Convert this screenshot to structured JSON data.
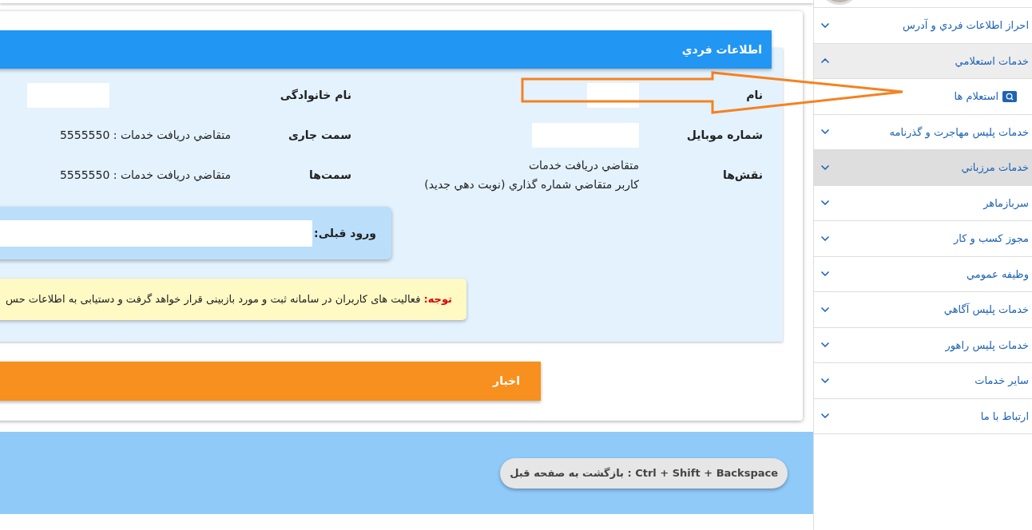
{
  "profile_card": {
    "title": "اطلاعات فردي",
    "fields": [
      {
        "label": "نام",
        "kind": "redacted"
      },
      {
        "label": "نام خانوادگی",
        "kind": "redacted"
      },
      {
        "label": "شماره موبایل",
        "kind": "redacted"
      },
      {
        "label": "سمت جاری",
        "kind": "text",
        "lines": [
          "متقاضي دريافت خدمات : 5555550"
        ]
      },
      {
        "label": "نقش‌ها",
        "kind": "text",
        "lines": [
          "متقاضي دريافت خدمات",
          "كاربر متقاضي شماره گذاري (نوبت دهي جديد)"
        ]
      },
      {
        "label": "سمت‌ها",
        "kind": "text",
        "lines": [
          "متقاضي دريافت خدمات : 5555550"
        ]
      }
    ],
    "last_login": {
      "label": "ورود قبلی:"
    },
    "notice": {
      "title": "توجه:",
      "text": "فعالیت های کاربران در سامانه ثبت و مورد بازبینی قرار خواهد گرفت و دستیابی به اطلاعات حس"
    }
  },
  "news": {
    "title": "اخبار"
  },
  "footer": {
    "hint": "Ctrl + Shift + Backspace : بازگشت به صفحه قبل"
  },
  "sidebar": {
    "items": [
      {
        "label": "احراز اطلاعات فردي و آدرس",
        "expanded": false,
        "selected": false
      },
      {
        "label": "خدمات استعلامي",
        "expanded": true,
        "selected": false,
        "children": [
          {
            "label": "استعلام ها"
          }
        ]
      },
      {
        "label": "خدمات پلیس مهاجرت و گذرنامه",
        "expanded": false,
        "selected": false
      },
      {
        "label": "خدمات مرزباني",
        "expanded": false,
        "selected": true
      },
      {
        "label": "سربازماهر",
        "expanded": false,
        "selected": false
      },
      {
        "label": "مجوز کسب و کار",
        "expanded": false,
        "selected": false
      },
      {
        "label": "وظيفه عمومي",
        "expanded": false,
        "selected": false
      },
      {
        "label": "خدمات پلیس آگاهي",
        "expanded": false,
        "selected": false
      },
      {
        "label": "خدمات پلیس راهور",
        "expanded": false,
        "selected": false
      },
      {
        "label": "ساير خدمات",
        "expanded": false,
        "selected": false
      },
      {
        "label": "ارتباط با ما",
        "expanded": false,
        "selected": false
      }
    ]
  }
}
